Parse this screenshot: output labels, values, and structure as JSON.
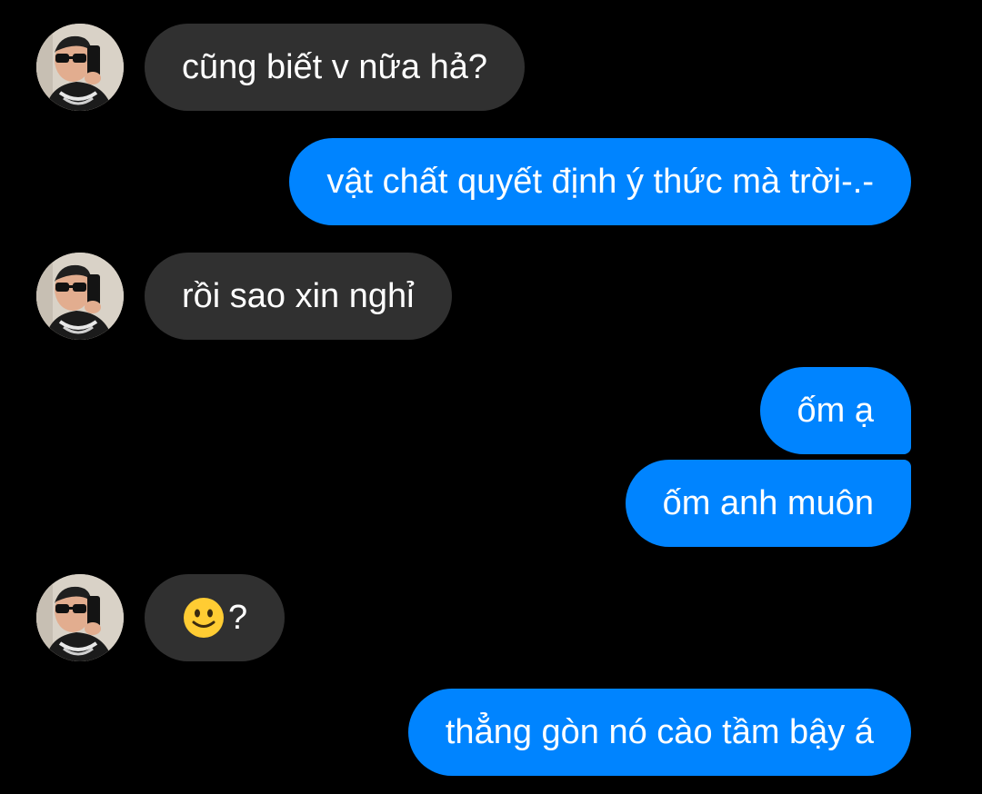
{
  "chat": {
    "messages": [
      {
        "sender": "contact",
        "text": "cũng biết v nữa hả?"
      },
      {
        "sender": "me",
        "text": "vật chất quyết định ý thức mà trời-.-"
      },
      {
        "sender": "contact",
        "text": "rồi sao xin nghỉ"
      },
      {
        "sender": "me",
        "text": "ốm ạ"
      },
      {
        "sender": "me",
        "text": "ốm anh muôn"
      },
      {
        "sender": "contact",
        "emoji": "slightly-smiling-face-icon",
        "text": "?"
      },
      {
        "sender": "me",
        "text": "thẳng gòn nó cào tầm bậy á"
      }
    ]
  },
  "colors": {
    "background": "#000000",
    "incoming_bubble": "#303030",
    "outgoing_bubble": "#0084ff",
    "text": "#ffffff"
  }
}
